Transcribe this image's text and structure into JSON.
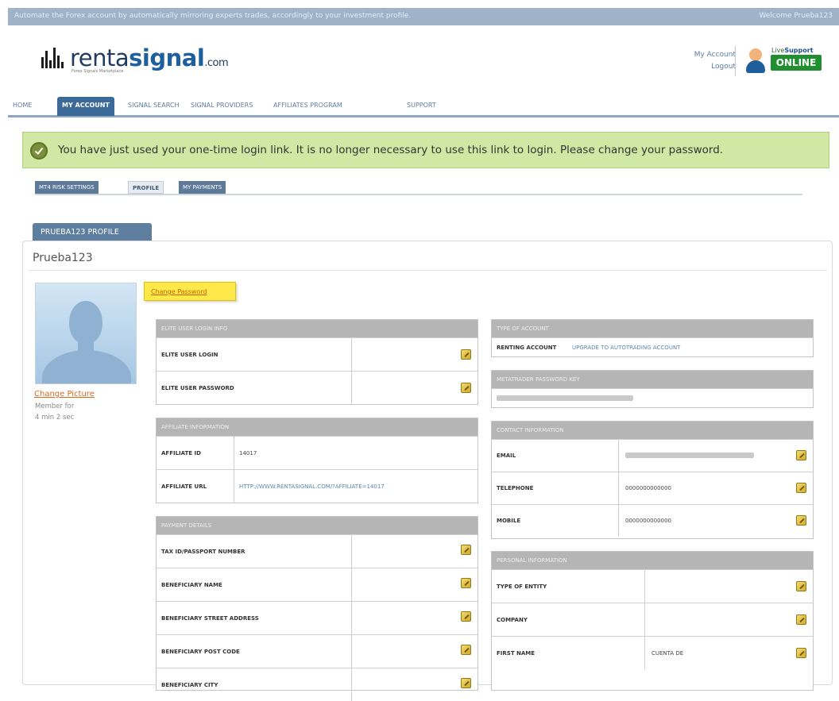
{
  "topbar": {
    "message": "Automate the Forex account by automatically mirroring experts trades, accordingly to your investment profile.",
    "welcome": "Welcome Prueba123"
  },
  "logo": {
    "name_part1": "renta",
    "name_part2": "signal",
    "name_part3": ".com",
    "tagline": "Forex Signals Marketplace"
  },
  "account_links": {
    "my_account": "My Account",
    "logout": "Logout"
  },
  "live_support": {
    "label_live": "Live",
    "label_support": "Support",
    "status": "ONLINE"
  },
  "nav": {
    "items": [
      "HOME",
      "MY ACCOUNT",
      "SIGNAL SEARCH",
      "SIGNAL PROVIDERS",
      "AFFILIATES PROGRAM",
      "SUPPORT"
    ],
    "active": "MY ACCOUNT"
  },
  "notice": {
    "text": "You have just used your one-time login link. It is no longer necessary to use this link to login. Please change your password."
  },
  "subtabs": {
    "items": [
      "MT4 RISK SETTINGS",
      "PROFILE",
      "MY PAYMENTS"
    ],
    "active": "PROFILE"
  },
  "profile": {
    "tab_title": "PRUEBA123 PROFILE",
    "username": "Prueba123",
    "change_picture": "Change Picture",
    "member_for_label": "Member for",
    "member_for_value": "4 min 2 sec",
    "change_password": "Change Password"
  },
  "elite_login": {
    "header": "ELITE USER LOGIN INFO",
    "rows": [
      {
        "label": "ELITE USER LOGIN",
        "value": ""
      },
      {
        "label": "ELITE USER PASSWORD",
        "value": ""
      }
    ]
  },
  "affiliate": {
    "header": "AFFILIATE INFORMATION",
    "rows": [
      {
        "label": "AFFILIATE ID",
        "value": "14017"
      },
      {
        "label": "AFFILIATE URL",
        "value": "HTTP://WWW.RENTASIGNAL.COM/?AFFILIATE=14017"
      }
    ]
  },
  "payment": {
    "header": "PAYMENT DETAILS",
    "rows": [
      {
        "label": "TAX ID/PASSPORT NUMBER"
      },
      {
        "label": "BENEFICIARY NAME"
      },
      {
        "label": "BENEFICIARY STREET ADDRESS"
      },
      {
        "label": "BENEFICIARY POST CODE"
      },
      {
        "label": "BENEFICIARY CITY"
      }
    ]
  },
  "account_type": {
    "header": "TYPE OF ACCOUNT",
    "type": "RENTING ACCOUNT",
    "upgrade_link": "UPGRADE TO AUTOTRADING ACCOUNT"
  },
  "metatrader": {
    "header": "METATRADER PASSWORD KEY"
  },
  "contact": {
    "header": "CONTACT INFORMATION",
    "rows": [
      {
        "label": "EMAIL",
        "value": ""
      },
      {
        "label": "TELEPHONE",
        "value": "0000000000000"
      },
      {
        "label": "MOBILE",
        "value": "0000000000000"
      }
    ]
  },
  "personal": {
    "header": "PERSONAL INFORMATION",
    "rows": [
      {
        "label": "TYPE OF ENTITY",
        "value": ""
      },
      {
        "label": "COMPANY",
        "value": ""
      },
      {
        "label": "FIRST NAME",
        "value": "CUENTA DE"
      }
    ]
  }
}
